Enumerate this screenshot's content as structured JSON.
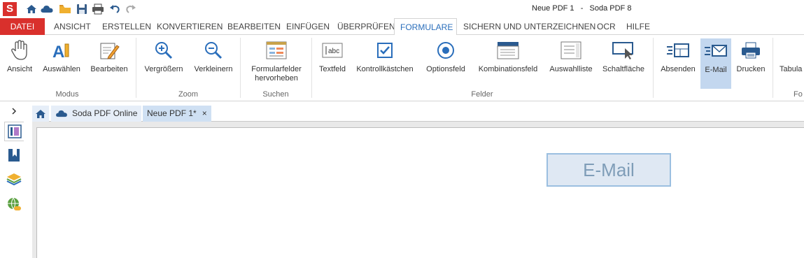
{
  "title_bar": {
    "app_logo_letter": "S",
    "window_title": "Neue PDF 1   -   Soda PDF 8",
    "quick_access": [
      "home-icon",
      "cloud-icon",
      "open-folder-icon",
      "save-icon",
      "print-icon",
      "undo-icon",
      "redo-icon"
    ]
  },
  "menu": {
    "tabs": [
      "DATEI",
      "ANSICHT",
      "ERSTELLEN",
      "KONVERTIEREN",
      "BEARBEITEN",
      "EINFÜGEN",
      "ÜBERPRÜFEN",
      "FORMULARE",
      "SICHERN UND UNTERZEICHNEN",
      "OCR",
      "HILFE"
    ],
    "active": "FORMULARE"
  },
  "ribbon": {
    "groups": {
      "modus": "Modus",
      "zoom": "Zoom",
      "suchen": "Suchen",
      "felder": "Felder",
      "cut": "Fo"
    },
    "buttons": {
      "ansicht": "Ansicht",
      "auswaehlen": "Auswählen",
      "bearbeiten": "Bearbeiten",
      "vergroessern": "Vergrößern",
      "verkleinern": "Verkleinern",
      "formularfelder_line1": "Formularfelder",
      "formularfelder_line2": "hervorheben",
      "textfeld": "Textfeld",
      "kontrollkaestchen": "Kontrollkästchen",
      "optionsfeld": "Optionsfeld",
      "kombinationsfeld": "Kombinationsfeld",
      "auswahlliste": "Auswahlliste",
      "schaltflaeche": "Schaltfläche",
      "absenden": "Absenden",
      "email": "E-Mail",
      "drucken": "Drucken",
      "tabula": "Tabula"
    },
    "selected": "E-Mail"
  },
  "doc_tabs": {
    "home": "home-icon",
    "online": "Soda PDF Online",
    "current": "Neue PDF 1*",
    "close": "×"
  },
  "document": {
    "form_button_label": "E-Mail"
  },
  "colors": {
    "brand_red": "#d9302c",
    "accent_blue": "#2a6ebb",
    "selected_bg": "#c3d7ef"
  }
}
